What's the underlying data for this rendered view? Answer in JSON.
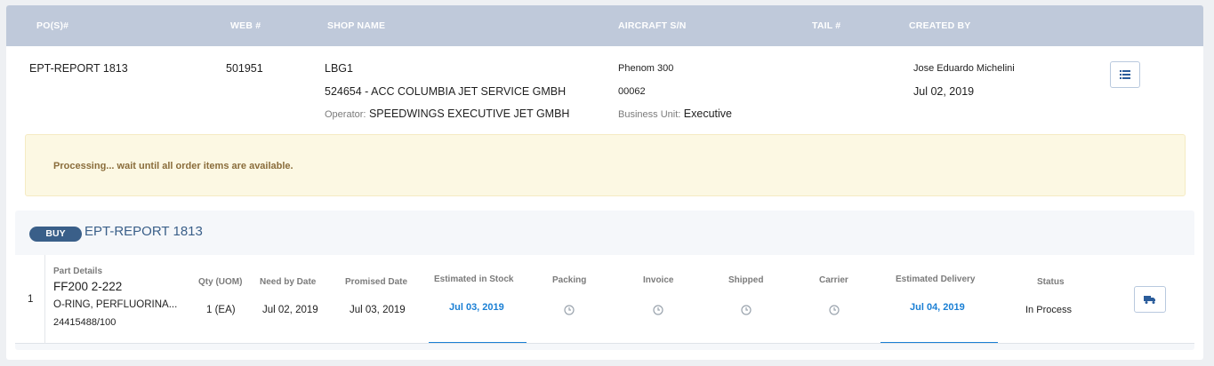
{
  "header": {
    "pos_label": "PO(S)#",
    "web_label": "WEB #",
    "shop_label": "SHOP NAME",
    "aircraft_label": "AIRCRAFT S/N",
    "tail_label": "TAIL #",
    "created_label": "CREATED BY"
  },
  "row": {
    "po": "EPT-REPORT 1813",
    "web": "501951",
    "shop_code": "LBG1",
    "shop_name": "524654 - ACC COLUMBIA JET SERVICE GMBH",
    "operator_label": "Operator:",
    "operator": "SPEEDWINGS EXECUTIVE JET GMBH",
    "aircraft": "Phenom 300",
    "aircraft_sn": "00062",
    "bu_label": "Business Unit:",
    "bu": "Executive",
    "created_by": "Jose Eduardo Michelini",
    "created_date": "Jul 02, 2019",
    "list_icon": "list-icon"
  },
  "alert": {
    "text": "Processing... wait until all order items are available."
  },
  "order": {
    "badge": "BUY",
    "title": "EPT-REPORT 1813",
    "columns": {
      "part": "Part Details",
      "qty": "Qty (UOM)",
      "need": "Need by Date",
      "promised": "Promised Date",
      "est_stock": "Estimated in Stock",
      "packing": "Packing",
      "invoice": "Invoice",
      "shipped": "Shipped",
      "carrier": "Carrier",
      "est_delivery": "Estimated Delivery",
      "status": "Status"
    },
    "item": {
      "index": "1",
      "part_number": "FF200 2-222",
      "description": "O-RING, PERFLUORINA...",
      "ref": "24415488/100",
      "qty": "1 (EA)",
      "need": "Jul 02, 2019",
      "promised": "Jul 03, 2019",
      "est_stock": "Jul 03, 2019",
      "est_delivery": "Jul 04, 2019",
      "status": "In Process",
      "truck_icon": "truck-icon",
      "clock_icon": "clock-icon"
    }
  },
  "colors": {
    "header_bg": "#bfc9da",
    "accent": "#3a5f89",
    "link": "#1a7fd4",
    "alert_bg": "#fcf8e3",
    "alert_text": "#8a6d3b"
  }
}
